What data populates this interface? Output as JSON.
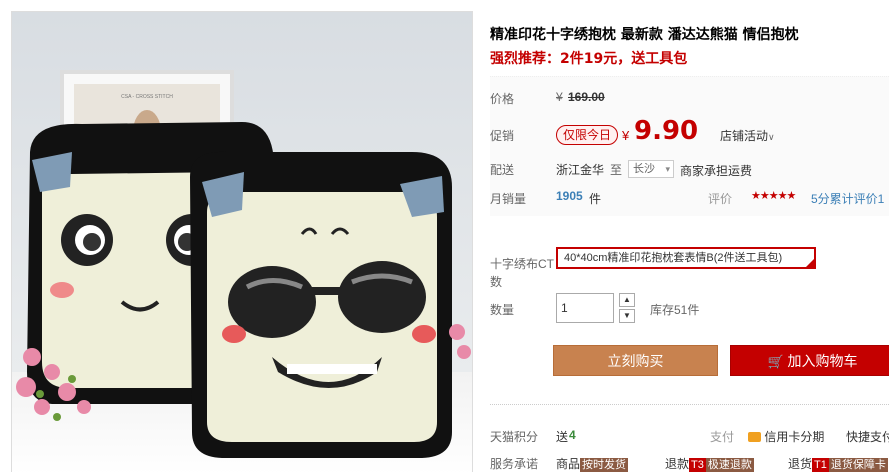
{
  "product": {
    "title": "精准印花十字绣抱枕 最新款 潘达达熊猫 情侣抱枕",
    "promo": "强烈推荐：2件19元，送工具包"
  },
  "price": {
    "label": "价格",
    "currency": "¥",
    "original": "169.00"
  },
  "promotion": {
    "label": "促销",
    "badge": "仅限今日",
    "currency": "¥",
    "price": "9.90",
    "store_activity": "店铺活动"
  },
  "delivery": {
    "label": "配送",
    "from": "浙江金华",
    "to_label": "至",
    "to_city": "长沙",
    "fee_note": "商家承担运费"
  },
  "sales": {
    "label": "月销量",
    "count": "1905",
    "unit": "件",
    "review_label": "评价",
    "stars": "★★★★★",
    "rating_text": "5分累计评价1"
  },
  "variant": {
    "label_line1": "十字绣布CT",
    "label_line2": "数",
    "selected": "40*40cm精准印花抱枕套表情B(2件送工具包)"
  },
  "quantity": {
    "label": "数量",
    "value": "1",
    "stock": "库存51件"
  },
  "actions": {
    "buy_now": "立刻购买",
    "add_to_cart": "加入购物车"
  },
  "footer": {
    "points_label": "天猫积分",
    "points_prefix": "送",
    "points_value": "4",
    "pay_label": "支付",
    "credit_label": "信用卡分期",
    "quick_pay": "快捷支付",
    "service_label": "服务承诺",
    "service_item1_prefix": "商品",
    "service_item1_tag": "按时发货",
    "service_item2_prefix": "退款",
    "service_item2_code": "T3",
    "service_item2_tag": "极速退款",
    "service_item3_prefix": "退货",
    "service_item3_code": "T1",
    "service_item3_tag": "退货保障卡"
  },
  "photo": {
    "frame_caption": "CSA - CROSS STITCH"
  },
  "colors": {
    "tmall_red": "#c40000",
    "buy_button": "#c8824f"
  },
  "icons": [
    "chevron-down-icon",
    "cart-icon",
    "credit-card-icon",
    "star-icon"
  ]
}
